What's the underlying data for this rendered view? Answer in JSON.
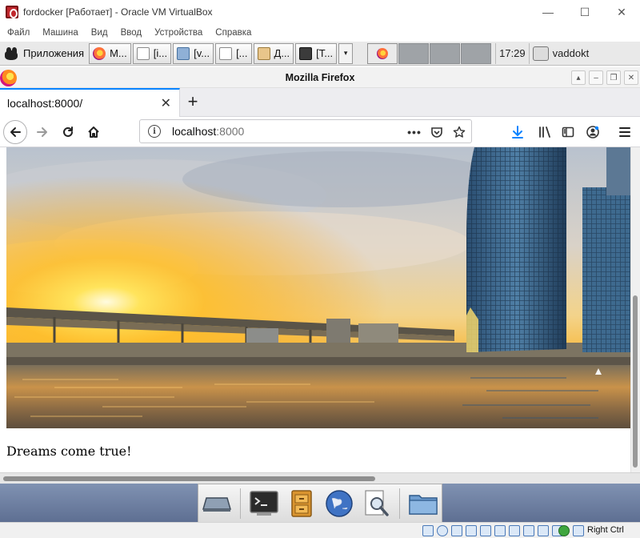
{
  "host": {
    "title": "fordocker [Работает] - Oracle VM VirtualBox",
    "window_controls": [
      "—",
      "☐",
      "✕"
    ],
    "menu": [
      "Файл",
      "Машина",
      "Вид",
      "Ввод",
      "Устройства",
      "Справка"
    ],
    "host_key": "Right Ctrl"
  },
  "panel": {
    "apps_label": "Приложения",
    "tasks": [
      {
        "label": "М...",
        "icon": "firefox-icon"
      },
      {
        "label": "[i...",
        "icon": "text-editor-icon"
      },
      {
        "label": "[v...",
        "icon": "folder-icon"
      },
      {
        "label": "[...",
        "icon": "document-icon"
      },
      {
        "label": "Д...",
        "icon": "file-manager-icon"
      },
      {
        "label": "[Т...",
        "icon": "terminal-icon"
      }
    ],
    "clock": "17:29",
    "user": "vaddokt"
  },
  "firefox": {
    "window_title": "Mozilla Firefox",
    "tab_title": "localhost:8000/",
    "url_host": "localhost",
    "url_port": ":8000",
    "new_tab": "+"
  },
  "page": {
    "caption": "Dreams come true!"
  },
  "colors": {
    "accent": "#0a84ff",
    "download_icon": "#0a84ff",
    "dock_background": "#6f80a2"
  }
}
